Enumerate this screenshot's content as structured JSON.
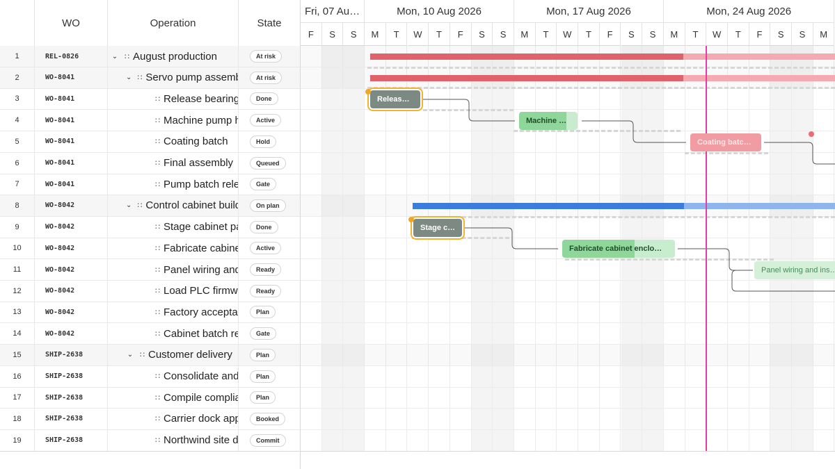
{
  "grid": {
    "headers": {
      "wo": "WO",
      "operation": "Operation",
      "state": "State"
    },
    "rows": [
      {
        "num": "1",
        "wo": "REL-0826",
        "op": "August production",
        "state": "At risk",
        "level": 0,
        "parent": true
      },
      {
        "num": "2",
        "wo": "WO-8041",
        "op": "Servo pump assembly",
        "state": "At risk",
        "level": 1,
        "parent": true
      },
      {
        "num": "3",
        "wo": "WO-8041",
        "op": "Release bearing kit",
        "state": "Done",
        "level": 2,
        "parent": false
      },
      {
        "num": "4",
        "wo": "WO-8041",
        "op": "Machine pump housing",
        "state": "Active",
        "level": 2,
        "parent": false
      },
      {
        "num": "5",
        "wo": "WO-8041",
        "op": "Coating batch",
        "state": "Hold",
        "level": 2,
        "parent": false
      },
      {
        "num": "6",
        "wo": "WO-8041",
        "op": "Final assembly",
        "state": "Queued",
        "level": 2,
        "parent": false
      },
      {
        "num": "7",
        "wo": "WO-8041",
        "op": "Pump batch release",
        "state": "Gate",
        "level": 2,
        "parent": false
      },
      {
        "num": "8",
        "wo": "WO-8042",
        "op": "Control cabinet build",
        "state": "On plan",
        "level": 1,
        "parent": true
      },
      {
        "num": "9",
        "wo": "WO-8042",
        "op": "Stage cabinet parts",
        "state": "Done",
        "level": 2,
        "parent": false
      },
      {
        "num": "10",
        "wo": "WO-8042",
        "op": "Fabricate cabinet enclosure",
        "state": "Active",
        "level": 2,
        "parent": false
      },
      {
        "num": "11",
        "wo": "WO-8042",
        "op": "Panel wiring and inspection",
        "state": "Ready",
        "level": 2,
        "parent": false
      },
      {
        "num": "12",
        "wo": "WO-8042",
        "op": "Load PLC firmware",
        "state": "Ready",
        "level": 2,
        "parent": false
      },
      {
        "num": "13",
        "wo": "WO-8042",
        "op": "Factory acceptance",
        "state": "Plan",
        "level": 2,
        "parent": false
      },
      {
        "num": "14",
        "wo": "WO-8042",
        "op": "Cabinet batch release",
        "state": "Gate",
        "level": 2,
        "parent": false
      },
      {
        "num": "15",
        "wo": "SHIP-2638",
        "op": "Customer delivery",
        "state": "Plan",
        "level": 1,
        "parent": true
      },
      {
        "num": "16",
        "wo": "SHIP-2638",
        "op": "Consolidate and pack",
        "state": "Plan",
        "level": 2,
        "parent": false
      },
      {
        "num": "17",
        "wo": "SHIP-2638",
        "op": "Compile compliance docs",
        "state": "Plan",
        "level": 2,
        "parent": false
      },
      {
        "num": "18",
        "wo": "SHIP-2638",
        "op": "Carrier dock appointment",
        "state": "Booked",
        "level": 2,
        "parent": false
      },
      {
        "num": "19",
        "wo": "SHIP-2638",
        "op": "Northwind site delivery",
        "state": "Commit",
        "level": 2,
        "parent": false
      }
    ]
  },
  "timeline": {
    "weeks": [
      "Fri, 07 Au…",
      "Mon, 10 Aug 2026",
      "Mon, 17 Aug 2026",
      "Mon, 24 Aug 2026"
    ],
    "days": [
      "F",
      "S",
      "S",
      "M",
      "T",
      "W",
      "T",
      "F",
      "S",
      "S",
      "M",
      "T",
      "W",
      "T",
      "F",
      "S",
      "S",
      "M",
      "T",
      "W",
      "T",
      "F",
      "S",
      "S",
      "M"
    ],
    "tasks": [
      {
        "label": "Releas…",
        "row": 3
      },
      {
        "label": "Machine …",
        "row": 4
      },
      {
        "label": "Coating batc…",
        "row": 5
      },
      {
        "label": "Stage c…",
        "row": 9
      },
      {
        "label": "Fabricate cabinet enclo…",
        "row": 10
      },
      {
        "label": "Panel wiring and ins…",
        "row": 11
      }
    ]
  },
  "colors": {
    "at_risk": "#e0626a",
    "on_plan": "#3b7ddd",
    "done": "#7d8a84",
    "active": "#8fd69a",
    "today": "#e53ca6",
    "selection": "#f2b233"
  }
}
